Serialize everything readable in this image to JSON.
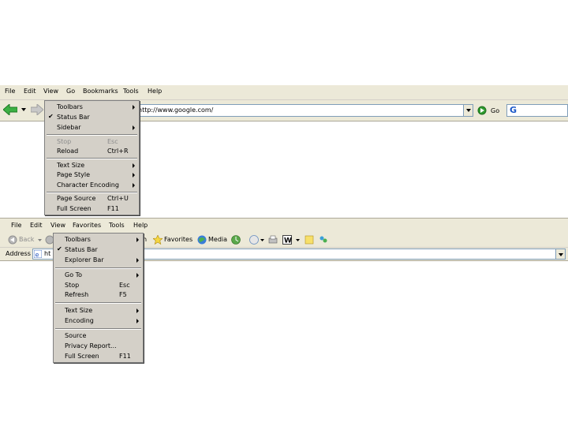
{
  "browser1": {
    "menubar": [
      "File",
      "Edit",
      "View",
      "Go",
      "Bookmarks",
      "Tools",
      "Help"
    ],
    "address_value": "http://www.google.com/",
    "go_label": "Go",
    "search_logo": "G",
    "view_menu": {
      "toolbars": "Toolbars",
      "status_bar": "Status Bar",
      "sidebar": "Sidebar",
      "stop": "Stop",
      "stop_shortcut": "Esc",
      "reload": "Reload",
      "reload_shortcut": "Ctrl+R",
      "text_size": "Text Size",
      "page_style": "Page Style",
      "character_encoding": "Character Encoding",
      "page_source": "Page Source",
      "page_source_shortcut": "Ctrl+U",
      "full_screen": "Full Screen",
      "full_screen_shortcut": "F11",
      "check": "✔"
    }
  },
  "browser2": {
    "menubar": [
      "File",
      "Edit",
      "View",
      "Favorites",
      "Tools",
      "Help"
    ],
    "toolbar": {
      "back": "Back",
      "favorites": "Favorites",
      "media": "Media"
    },
    "address_label": "Address",
    "address_value": "ht",
    "view_menu": {
      "toolbars": "Toolbars",
      "status_bar": "Status Bar",
      "explorer_bar": "Explorer Bar",
      "go_to": "Go To",
      "stop": "Stop",
      "stop_shortcut": "Esc",
      "refresh": "Refresh",
      "refresh_shortcut": "F5",
      "text_size": "Text Size",
      "encoding": "Encoding",
      "source": "Source",
      "privacy_report": "Privacy Report...",
      "full_screen": "Full Screen",
      "full_screen_shortcut": "F11",
      "check": "✔",
      "favorites_partial": "h"
    }
  },
  "colors": {
    "chrome": "#ece9d8",
    "menu": "#d4d0c8",
    "back_arrow": "#3cb043",
    "go_icon": "#2e9b2e"
  }
}
